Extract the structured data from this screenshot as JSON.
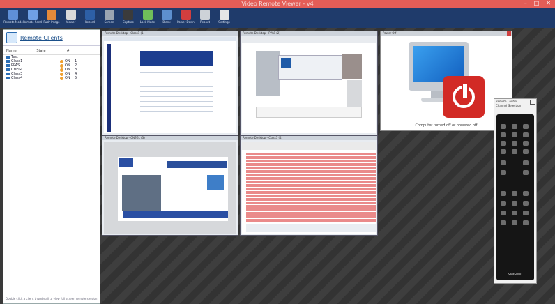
{
  "window": {
    "title": "Video Remote Viewer - v4",
    "controls": [
      "–",
      "□",
      "✕"
    ]
  },
  "toolbar": [
    {
      "label": "Remote Mode",
      "icon": "monitor-icon",
      "color": "#5f8fd8"
    },
    {
      "label": "Remote Send",
      "icon": "send-icon",
      "color": "#6fa0e6"
    },
    {
      "label": "Push Image",
      "icon": "image-icon",
      "color": "#e58a3a"
    },
    {
      "label": "Viewer",
      "icon": "viewer-icon",
      "color": "#d9d9d9"
    },
    {
      "label": "Record",
      "icon": "record-icon",
      "color": "#2d5fa6"
    },
    {
      "label": "Screen",
      "icon": "screen-icon",
      "color": "#9aa4b1"
    },
    {
      "label": "Capture",
      "icon": "capture-icon",
      "color": "#3b3b3b"
    },
    {
      "label": "Lock Mode",
      "icon": "lock-icon",
      "color": "#6fbf5a"
    },
    {
      "label": "Blank",
      "icon": "blank-icon",
      "color": "#5d8fcf"
    },
    {
      "label": "Power Down",
      "icon": "power-icon",
      "color": "#d23e3e"
    },
    {
      "label": "Reboot",
      "icon": "reboot-icon",
      "color": "#cdd2d8"
    },
    {
      "label": "Settings",
      "icon": "gear-icon",
      "color": "#e6e6e6"
    }
  ],
  "sidebar": {
    "title": "Remote Clients",
    "columns": [
      "Name",
      "State",
      "#"
    ],
    "items": [
      {
        "name": "Test",
        "state": "",
        "count": ""
      },
      {
        "name": "Class1",
        "state": "ON",
        "count": "1"
      },
      {
        "name": "PPAS",
        "state": "ON",
        "count": "2"
      },
      {
        "name": "CNEGL",
        "state": "ON",
        "count": "3"
      },
      {
        "name": "Class3",
        "state": "ON",
        "count": "4"
      },
      {
        "name": "Class4",
        "state": "ON",
        "count": "5"
      }
    ],
    "footer": "Double click a client thumbnail to view full screen remote session"
  },
  "thumbnails": [
    {
      "caption": "Remote Desktop - Class1 (1)"
    },
    {
      "caption": "Remote Desktop - PPAS (2)"
    },
    {
      "caption": "Remote Desktop - CNEGL (3)"
    },
    {
      "caption": "Remote Desktop - Class3 (4)"
    }
  ],
  "power_window": {
    "caption": "Power Off",
    "message": "Computer turned off or powered off"
  },
  "remote": {
    "caption": "Remote Control",
    "subtitle": "Channel Selection",
    "brand": "SAMSUNG"
  }
}
